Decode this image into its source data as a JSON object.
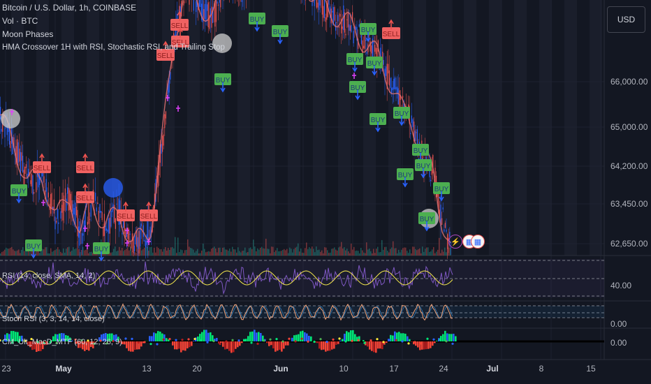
{
  "legend": {
    "title": "Bitcoin / U.S. Dollar, 1h, COINBASE",
    "vol": "Vol · BTC",
    "moon": "Moon Phases",
    "strategy": "HMA Crossover 1H with RSI, Stochastic RSI, and Trailing Stop"
  },
  "currency_button": "USD",
  "pane_labels": {
    "rsi": "RSI (14, close, SMA, 14, 2)",
    "stoch": "Stoch RSI (3, 3, 14, 14, close)",
    "macd": "CM_Ult_MacD_MTF (60, 12, 26, 9)"
  },
  "y_ticks": [
    "66,000.00",
    "65,000.00",
    "64,200.00",
    "63,450.00",
    "62,650.00"
  ],
  "rsi_tick": "40.00",
  "stoch_tick": "0.00",
  "macd_tick": "0.00",
  "x_ticks": [
    "23",
    "May",
    "13",
    "20",
    "Jun",
    "10",
    "17",
    "24",
    "Jul",
    "8",
    "15"
  ],
  "signal_labels": {
    "buy": "BUY",
    "sell": "SELL"
  },
  "colors": {
    "background": "#131722",
    "up": "#ef5350",
    "down": "#2962ff",
    "buy": "#4caf50",
    "sell": "#f06262",
    "rsi": "#7e57c2",
    "rsi_ma": "#f5e94c",
    "stoch_k": "#f2a47a",
    "stoch_d": "#42a5f5",
    "moon": "#9e9e9e"
  },
  "icons": [
    "lightning-icon",
    "us-flag-icon",
    "us-flag-icon"
  ],
  "chart_data": {
    "type": "line",
    "title": "Bitcoin / U.S. Dollar, 1h, COINBASE",
    "x": [
      "Apr 23",
      "May 1",
      "May 13",
      "May 20",
      "Jun 1",
      "Jun 10",
      "Jun 17",
      "Jun 24",
      "Jul 1",
      "Jul 8",
      "Jul 15"
    ],
    "series": [
      {
        "name": "Bitcoin / U.S. Dollar, 1h, COINBASE",
        "values": [
          64400,
          63500,
          63300,
          66800,
          67500,
          66200,
          65300,
          62900,
          null,
          null,
          null
        ]
      }
    ],
    "ylim": [
      62600,
      66600
    ],
    "rsi_ticks": [
      40
    ],
    "grid": true
  }
}
